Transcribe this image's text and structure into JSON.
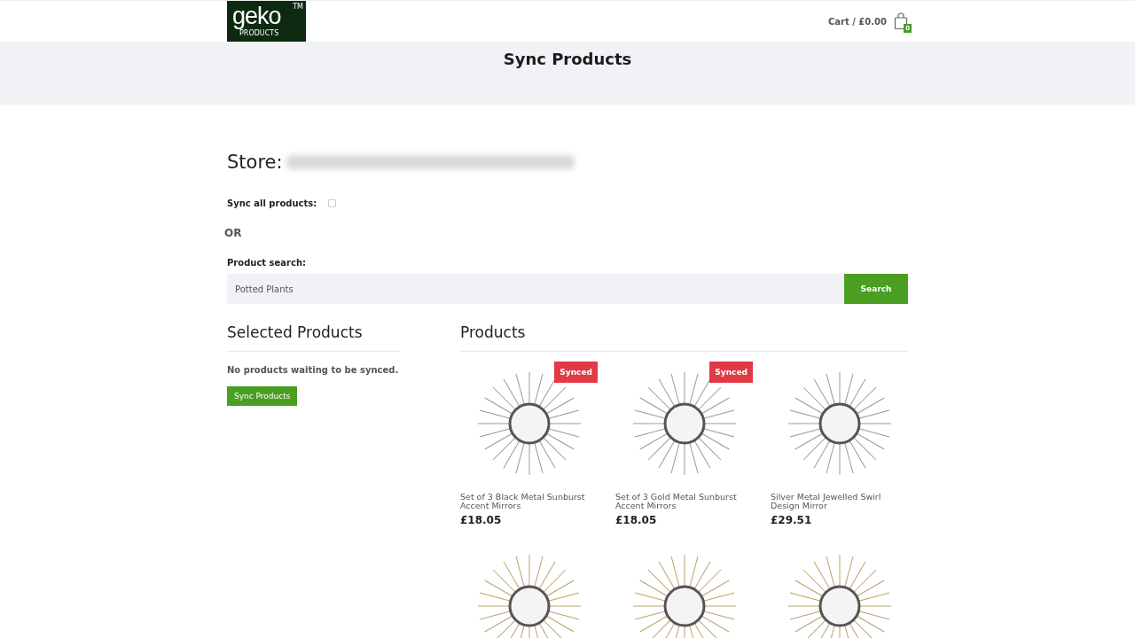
{
  "header": {
    "logo": {
      "word": "geko",
      "sub": "PRODUCTS",
      "mark": "TM"
    },
    "cart": {
      "label": "Cart / £0.00",
      "count": "0"
    }
  },
  "page_title": "Sync Products",
  "store": {
    "label": "Store:"
  },
  "sync_all": {
    "label": "Sync all products:",
    "checked": false
  },
  "separator": "OR",
  "search": {
    "label": "Product search:",
    "value": "Potted Plants",
    "button": "Search"
  },
  "selected_products": {
    "title": "Selected Products",
    "message": "No products waiting to be synced.",
    "button": "Sync Products"
  },
  "products": {
    "title": "Products",
    "items": [
      {
        "name": "Set of 3 Black Metal Sunburst Accent Mirrors",
        "price": "£18.05",
        "badge": "Synced"
      },
      {
        "name": "Set of 3 Gold Metal Sunburst Accent Mirrors",
        "price": "£18.05",
        "badge": "Synced"
      },
      {
        "name": "Silver Metal Jewelled Swirl Design Mirror",
        "price": "£29.51"
      }
    ]
  }
}
